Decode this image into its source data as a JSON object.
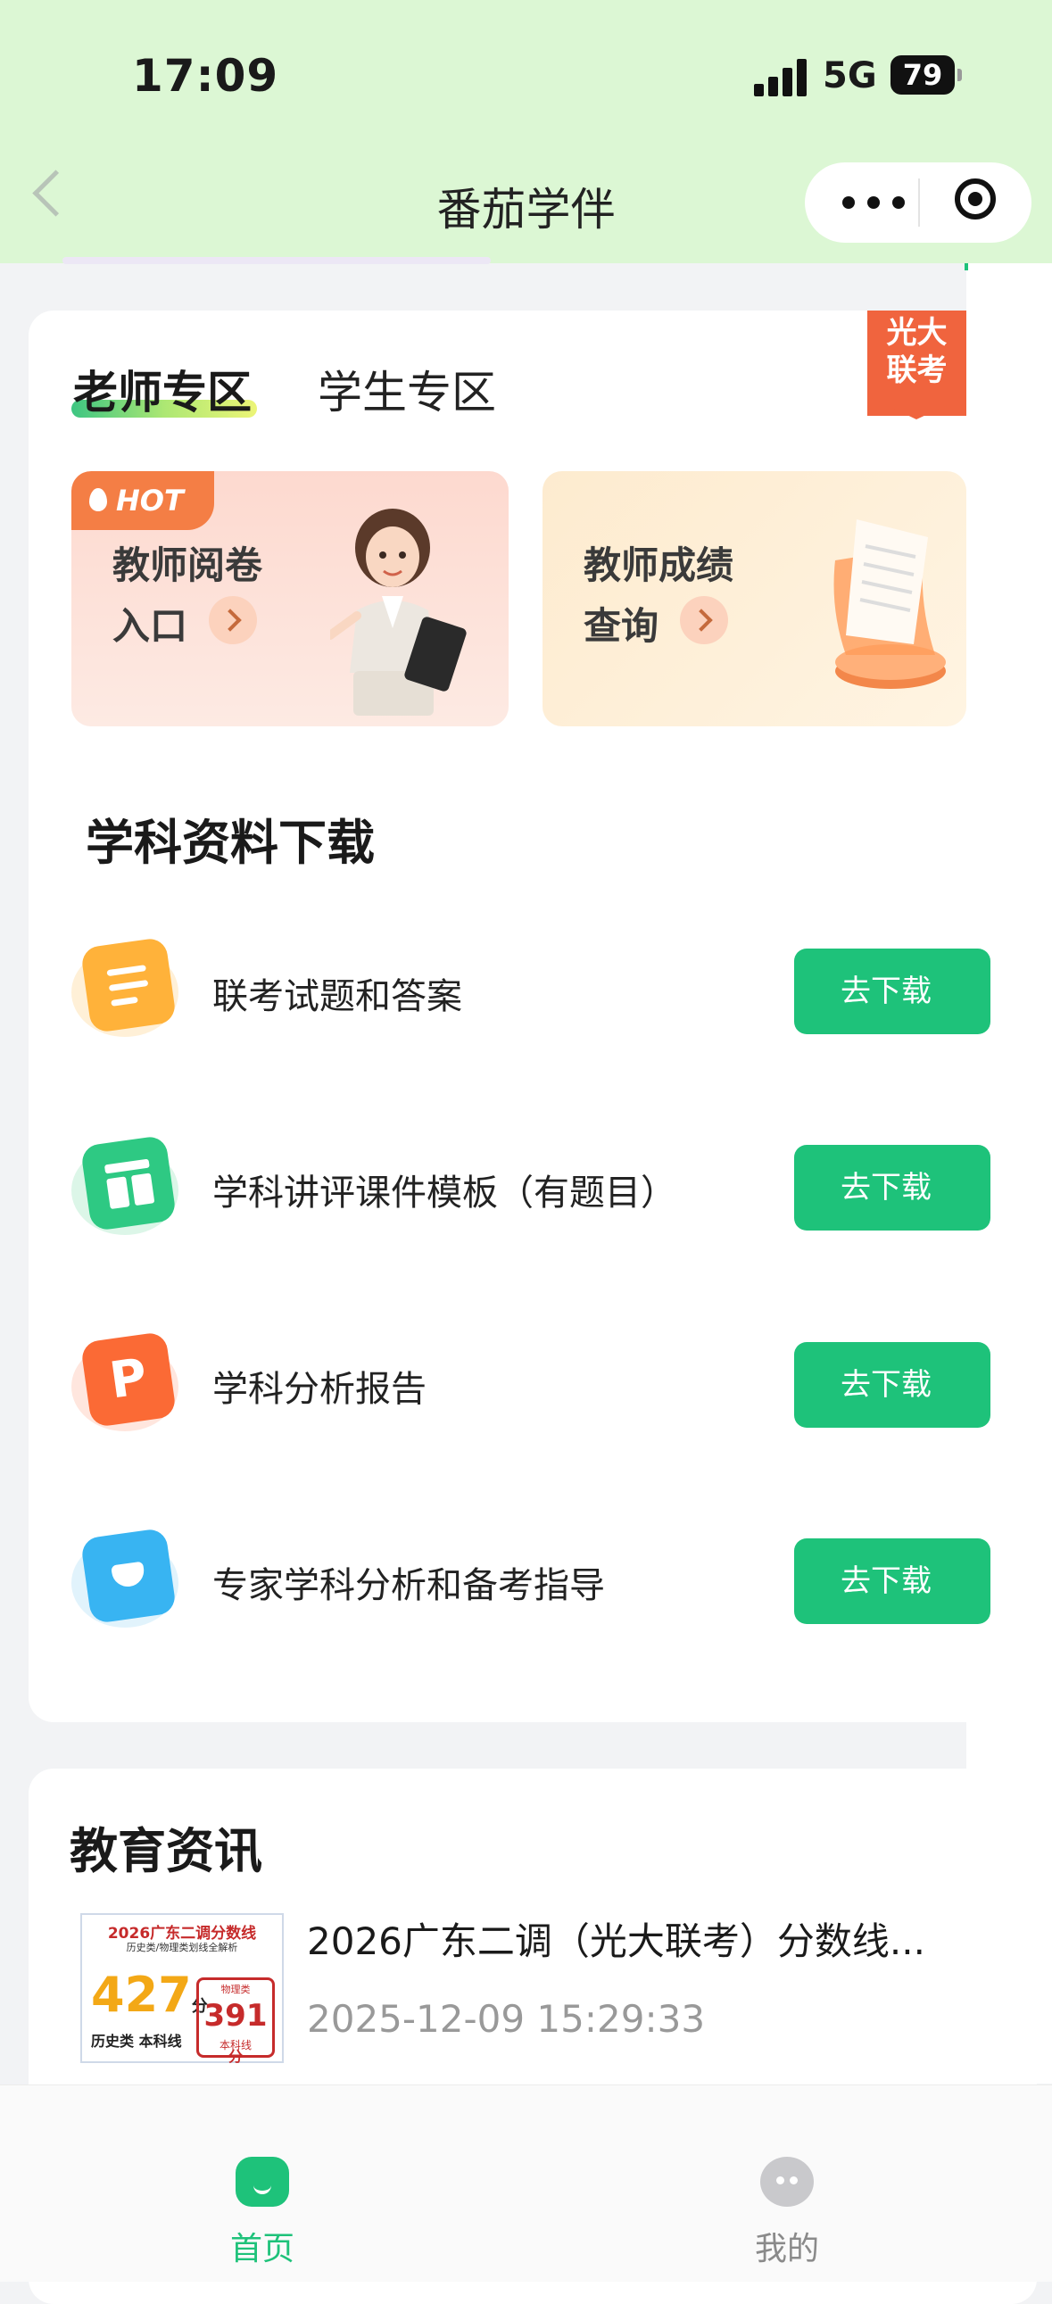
{
  "status_bar": {
    "time": "17:09",
    "network": "5G",
    "battery": "79"
  },
  "nav": {
    "title": "番茄学伴"
  },
  "tabs": [
    {
      "label": "老师专区",
      "active": true
    },
    {
      "label": "学生专区",
      "active": false
    }
  ],
  "ribbon": {
    "line1": "光大",
    "line2": "联考"
  },
  "feature_cards": [
    {
      "badge": "HOT",
      "line1": "教师阅卷",
      "line2": "入口"
    },
    {
      "line1": "教师成绩",
      "line2": "查询"
    }
  ],
  "section": {
    "title": "学科资料下载"
  },
  "downloads": [
    {
      "label": "联考试题和答案",
      "button": "去下载",
      "icon": "document-icon",
      "color": "#ffb23a"
    },
    {
      "label": "学科讲评课件模板（有题目）",
      "button": "去下载",
      "icon": "table-icon",
      "color": "#2ec983"
    },
    {
      "label": "学科分析报告",
      "button": "去下载",
      "icon": "ppt-icon",
      "color": "#fb6a35"
    },
    {
      "label": "专家学科分析和备考指导",
      "button": "去下载",
      "icon": "guide-icon",
      "color": "#38b4f2"
    }
  ],
  "news": {
    "title": "教育资讯",
    "items": [
      {
        "headline": "2026广东二调（光大联考）分数线...",
        "time": "2025-12-09 15:29:33",
        "thumb": {
          "title": "2026广东二调分数线",
          "subtitle": "历史类/物理类划线全解析",
          "big": "427",
          "big_unit": "分",
          "sub": "历史类 本科线",
          "cal_title": "物理类",
          "cal_value": "391",
          "cal_unit": "分",
          "cal_sub": "本科线"
        }
      }
    ]
  },
  "tabbar": [
    {
      "label": "首页",
      "active": true
    },
    {
      "label": "我的",
      "active": false
    }
  ],
  "colors": {
    "accent": "#1ec27a",
    "header_bg": "#dcf7d4",
    "ribbon": "#f0643e"
  }
}
